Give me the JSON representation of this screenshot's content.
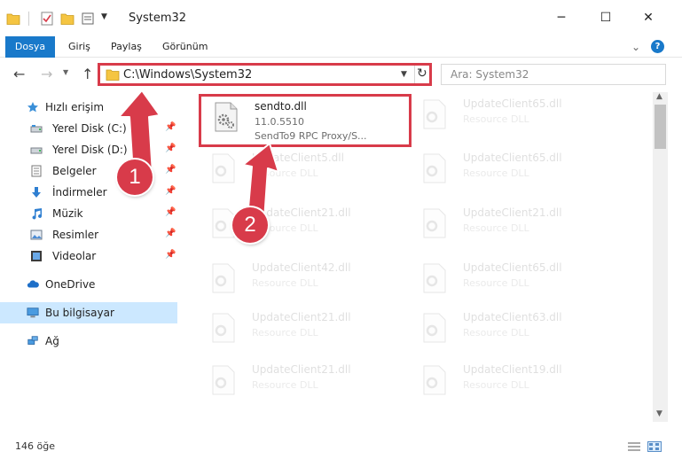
{
  "window": {
    "title": "System32",
    "controls": {
      "minimize": "─",
      "maximize": "☐",
      "close": "✕"
    }
  },
  "ribbon": {
    "tabs": [
      "Dosya",
      "Giriş",
      "Paylaş",
      "Görünüm"
    ],
    "help": "?"
  },
  "address": {
    "path": "C:\\Windows\\System32",
    "search_placeholder": "Ara: System32"
  },
  "nav_pane": {
    "items": [
      {
        "label": "Hızlı erişim",
        "icon": "star-icon",
        "pinned": false
      },
      {
        "label": "Yerel Disk (C:)",
        "icon": "drive-icon",
        "pinned": true
      },
      {
        "label": "Yerel Disk (D:)",
        "icon": "drive-icon",
        "pinned": true
      },
      {
        "label": "Belgeler",
        "icon": "documents-icon",
        "pinned": true
      },
      {
        "label": "İndirmeler",
        "icon": "download-icon",
        "pinned": true
      },
      {
        "label": "Müzik",
        "icon": "music-icon",
        "pinned": true
      },
      {
        "label": "Resimler",
        "icon": "pictures-icon",
        "pinned": true
      },
      {
        "label": "Videolar",
        "icon": "video-icon",
        "pinned": true
      },
      {
        "label": "OneDrive",
        "icon": "cloud-icon",
        "pinned": false
      },
      {
        "label": "Bu bilgisayar",
        "icon": "computer-icon",
        "pinned": false,
        "selected": true
      },
      {
        "label": "Ağ",
        "icon": "network-icon",
        "pinned": false
      }
    ]
  },
  "files": {
    "left": [
      {
        "name": "sendto.dll",
        "line1": "11.0.5510",
        "line2": "SendTo9 RPC Proxy/S...",
        "highlighted": true
      },
      {
        "name": "UpdateClient5.dll",
        "line1": "Resource DLL",
        "line2": ""
      },
      {
        "name": "UpdateClient21.dll",
        "line1": "Resource DLL",
        "line2": ""
      },
      {
        "name": "UpdateClient42.dll",
        "line1": "Resource DLL",
        "line2": ""
      },
      {
        "name": "UpdateClient21.dll",
        "line1": "Resource DLL",
        "line2": ""
      },
      {
        "name": "UpdateClient21.dll",
        "line1": "Resource DLL",
        "line2": ""
      }
    ],
    "right": [
      {
        "name": "UpdateClient65.dll",
        "line1": "Resource DLL",
        "line2": ""
      },
      {
        "name": "UpdateClient65.dll",
        "line1": "Resource DLL",
        "line2": ""
      },
      {
        "name": "UpdateClient21.dll",
        "line1": "Resource DLL",
        "line2": ""
      },
      {
        "name": "UpdateClient65.dll",
        "line1": "Resource DLL",
        "line2": ""
      },
      {
        "name": "UpdateClient63.dll",
        "line1": "Resource DLL",
        "line2": ""
      },
      {
        "name": "UpdateClient19.dll",
        "line1": "Resource DLL",
        "line2": ""
      }
    ]
  },
  "status": {
    "count": "146 öğe"
  },
  "annotations": {
    "step1": "1",
    "step2": "2",
    "color": "#d83b4a"
  }
}
